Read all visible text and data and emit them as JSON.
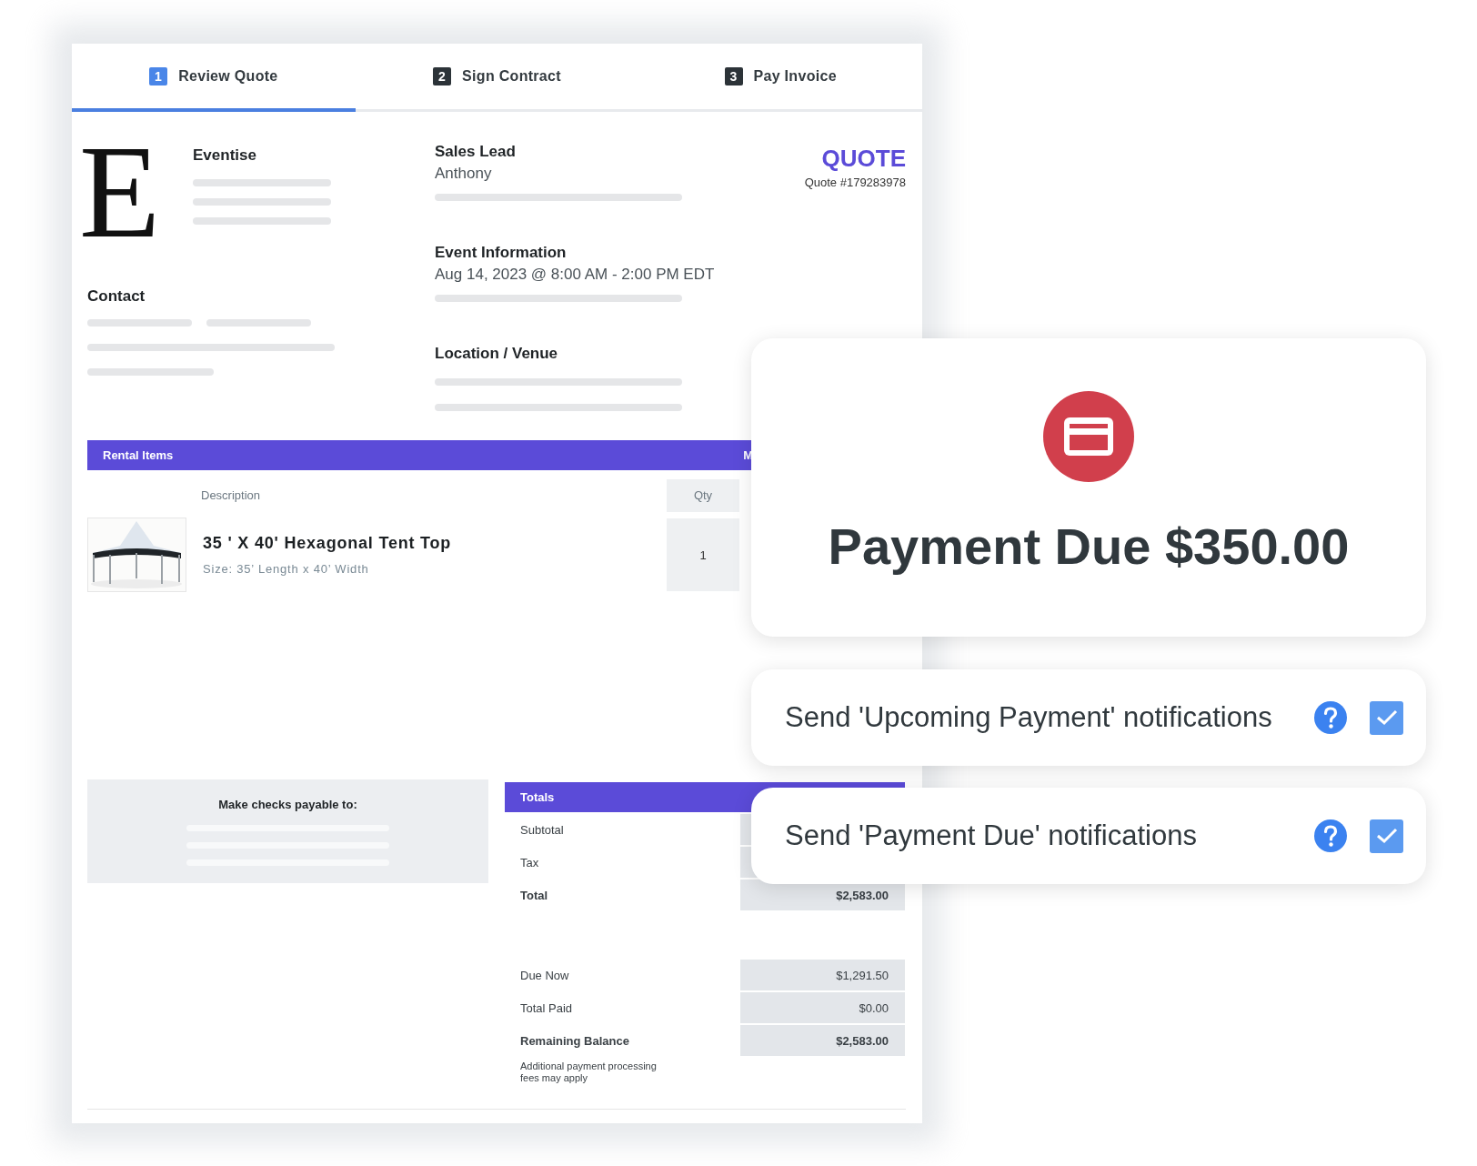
{
  "tabs": [
    {
      "number": "1",
      "label": "Review Quote",
      "selected": true
    },
    {
      "number": "2",
      "label": "Sign Contract",
      "selected": false
    },
    {
      "number": "3",
      "label": "Pay Invoice",
      "selected": false
    }
  ],
  "company": {
    "logo_letter": "E",
    "name": "Eventise"
  },
  "contact": {
    "title": "Contact"
  },
  "sales_lead": {
    "title": "Sales Lead",
    "name": "Anthony"
  },
  "event_information": {
    "title": "Event Information",
    "date": "Aug 14, 2023 @ 8:00 AM - 2:00 PM EDT"
  },
  "location": {
    "title": "Location / Venue"
  },
  "quote": {
    "title": "QUOTE",
    "number": "Quote #179283978"
  },
  "rental_items": {
    "title": "Rental Items",
    "column_3": "M",
    "columns": [
      "Description",
      "Qty"
    ],
    "rows": [
      {
        "name": "35 ' X 40' Hexagonal Tent Top",
        "size": "Size: 35’ Length x 40’ Width",
        "qty": "1"
      }
    ]
  },
  "payable": {
    "title": "Make checks payable to:"
  },
  "totals": {
    "title": "Totals",
    "rows": [
      {
        "label": "Subtotal",
        "bold": false
      },
      {
        "label": "Tax",
        "bold": false
      },
      {
        "label": "Total",
        "value": "$2,583.00",
        "bold": true
      }
    ],
    "balance_rows": [
      {
        "label": "Due Now",
        "value": "$1,291.50",
        "bold": false
      },
      {
        "label": "Total Paid",
        "value": "$0.00",
        "bold": false
      },
      {
        "label": "Remaining Balance",
        "value": "$2,583.00",
        "bold": true
      }
    ],
    "note": "Additional payment processing fees may apply"
  },
  "payment_card": {
    "title": "Payment Due $350.00"
  },
  "notifications": [
    {
      "label": "Send 'Upcoming Payment' notifications",
      "checked": true
    },
    {
      "label": "Send 'Payment Due' notifications",
      "checked": true
    }
  ]
}
